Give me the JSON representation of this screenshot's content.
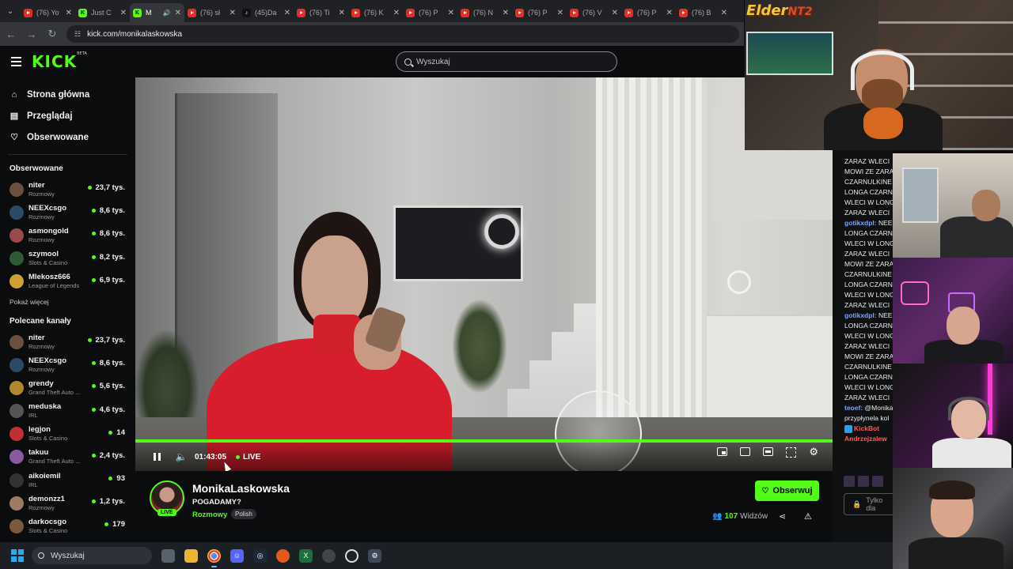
{
  "browser": {
    "tabs": [
      {
        "title": "(76) Yo",
        "favicon": "youtube",
        "active": false
      },
      {
        "title": "Just C",
        "favicon": "kick",
        "active": false
      },
      {
        "title": "M",
        "favicon": "kick",
        "active": true,
        "audio": true
      },
      {
        "title": "(76) sł",
        "favicon": "youtube",
        "active": false
      },
      {
        "title": "(45)Da",
        "favicon": "tiktok",
        "active": false
      },
      {
        "title": "(76) Ti",
        "favicon": "youtube",
        "active": false
      },
      {
        "title": "(76) K",
        "favicon": "youtube",
        "active": false
      },
      {
        "title": "(76) P",
        "favicon": "youtube",
        "active": false
      },
      {
        "title": "(76) N",
        "favicon": "youtube",
        "active": false
      },
      {
        "title": "(76) P",
        "favicon": "youtube",
        "active": false
      },
      {
        "title": "(76) V",
        "favicon": "youtube",
        "active": false
      },
      {
        "title": "(76) P",
        "favicon": "youtube",
        "active": false
      },
      {
        "title": "(76) B",
        "favicon": "youtube",
        "active": false
      }
    ],
    "url": "kick.com/monikalaskowska"
  },
  "header": {
    "logo": "KICK",
    "logo_badge": "BETA",
    "search_placeholder": "Wyszukaj"
  },
  "sidebar": {
    "nav": [
      {
        "label": "Strona główna",
        "icon": "home-icon"
      },
      {
        "label": "Przeglądaj",
        "icon": "browse-icon"
      },
      {
        "label": "Obserwowane",
        "icon": "heart-icon"
      }
    ],
    "followed_heading": "Obserwowane",
    "followed": [
      {
        "name": "niter",
        "category": "Rozmowy",
        "viewers": "23,7 tys.",
        "avatar_color": "#6b5040"
      },
      {
        "name": "NEEXcsgo",
        "category": "Rozmowy",
        "viewers": "8,6 tys.",
        "avatar_color": "#2b4a66"
      },
      {
        "name": "asmongold",
        "category": "Rozmowy",
        "viewers": "8,6 tys.",
        "avatar_color": "#9a4a4a"
      },
      {
        "name": "szymool",
        "category": "Slots & Casino",
        "viewers": "8,2 tys.",
        "avatar_color": "#2e5a34"
      },
      {
        "name": "Mlekosz666",
        "category": "League of Legends",
        "viewers": "6,9 tys.",
        "avatar_color": "#d0a030"
      }
    ],
    "show_more": "Pokaż więcej",
    "recommended_heading": "Polecane kanały",
    "recommended": [
      {
        "name": "niter",
        "category": "Rozmowy",
        "viewers": "23,7 tys.",
        "avatar_color": "#6b5040"
      },
      {
        "name": "NEEXcsgo",
        "category": "Rozmowy",
        "viewers": "8,6 tys.",
        "avatar_color": "#2b4a66"
      },
      {
        "name": "grendy",
        "category": "Grand Theft Auto ...",
        "viewers": "5,6 tys.",
        "avatar_color": "#b08a2a"
      },
      {
        "name": "meduska",
        "category": "IRL",
        "viewers": "4,6 tys.",
        "avatar_color": "#555"
      },
      {
        "name": "legjon",
        "category": "Slots & Casino",
        "viewers": "14",
        "avatar_color": "#c03030"
      },
      {
        "name": "takuu",
        "category": "Grand Theft Auto ...",
        "viewers": "2,4 tys.",
        "avatar_color": "#8a5aa0"
      },
      {
        "name": "aikoiemil",
        "category": "IRL",
        "viewers": "93",
        "avatar_color": "#333"
      },
      {
        "name": "demonzz1",
        "category": "Rozmowy",
        "viewers": "1,2 tys.",
        "avatar_color": "#a07a60"
      },
      {
        "name": "darkocsgo",
        "category": "Slots & Casino",
        "viewers": "179",
        "avatar_color": "#7a5a3a"
      }
    ]
  },
  "player": {
    "time": "01:43:05",
    "live_label": "LIVE"
  },
  "stream": {
    "channel": "MonikaLaskowska",
    "live_badge": "LIVE",
    "title": "POGADAMY?",
    "category": "Rozmowy",
    "tag": "Polish",
    "follow_label": "Obserwuj",
    "viewers_count": "107",
    "viewers_label": "Widzów"
  },
  "chat": {
    "lines": [
      {
        "user": "",
        "text": "ZARAZ WLECI",
        "color": ""
      },
      {
        "user": "",
        "text": "MOWI ZE ZARA",
        "color": ""
      },
      {
        "user": "",
        "text": "CZARNULKINE",
        "color": ""
      },
      {
        "user": "",
        "text": "LONGA CZARN",
        "color": ""
      },
      {
        "user": "",
        "text": "WLECI W LONG",
        "color": ""
      },
      {
        "user": "",
        "text": "ZARAZ WLECI",
        "color": ""
      },
      {
        "user": "gotikxdpl:",
        "text": " NEE",
        "color": "#7aa6ff"
      },
      {
        "user": "",
        "text": "LONGA CZARN",
        "color": ""
      },
      {
        "user": "",
        "text": "WLECI W LONG",
        "color": ""
      },
      {
        "user": "",
        "text": "ZARAZ WLECI",
        "color": ""
      },
      {
        "user": "",
        "text": "MOWI ZE ZARA",
        "color": ""
      },
      {
        "user": "",
        "text": "CZARNULKINE",
        "color": ""
      },
      {
        "user": "",
        "text": "LONGA CZARN",
        "color": ""
      },
      {
        "user": "",
        "text": "WLECI W LONG",
        "color": ""
      },
      {
        "user": "",
        "text": "ZARAZ WLECI",
        "color": ""
      },
      {
        "user": "gotikxdpl:",
        "text": " NEE",
        "color": "#7aa6ff"
      },
      {
        "user": "",
        "text": "LONGA CZARN",
        "color": ""
      },
      {
        "user": "",
        "text": "WLECI W LONG",
        "color": ""
      },
      {
        "user": "",
        "text": "ZARAZ WLECI",
        "color": ""
      },
      {
        "user": "",
        "text": "MOWI ZE ZARA",
        "color": ""
      },
      {
        "user": "",
        "text": "CZARNULKINE",
        "color": ""
      },
      {
        "user": "",
        "text": "LONGA CZARN",
        "color": ""
      },
      {
        "user": "",
        "text": "WLECI W LONG",
        "color": ""
      },
      {
        "user": "",
        "text": "ZARAZ WLECI",
        "color": ""
      },
      {
        "user": "teoef:",
        "text": " @Monika",
        "color": "#7aa6ff"
      },
      {
        "user": "",
        "text": "przypłynela kol",
        "color": ""
      },
      {
        "user": "KickBot",
        "text": "",
        "color": "#ff5a5a"
      },
      {
        "user": "Andrzejzalew",
        "text": "",
        "color": "#ff5a5a"
      }
    ],
    "input_placeholder": "Tylko dla"
  },
  "overlay": {
    "elder_text": "Elder",
    "elder_suffix": "NT2"
  },
  "taskbar": {
    "search_placeholder": "Wyszukaj"
  },
  "colors": {
    "accent": "#53fc18",
    "background": "#0b0c0e"
  }
}
